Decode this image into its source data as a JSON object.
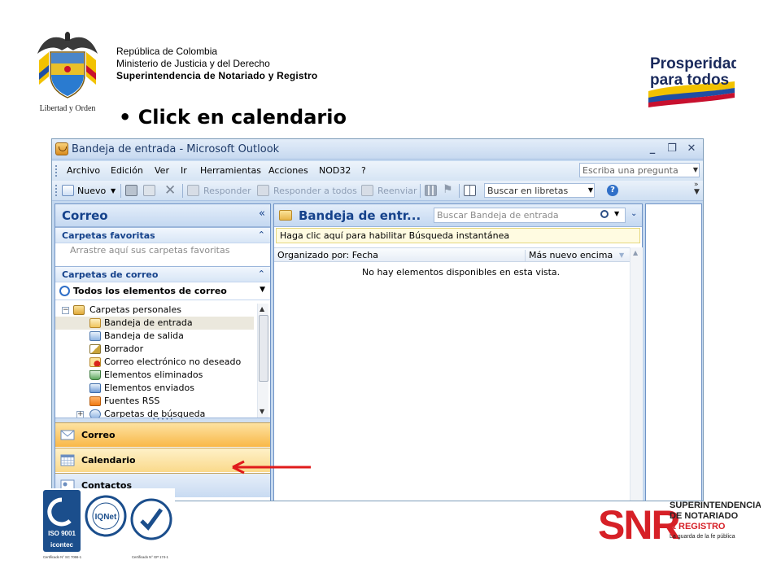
{
  "header": {
    "line1": "República de Colombia",
    "line2": "Ministerio de Justicia y del Derecho",
    "line3": "Superintendencia de Notariado y Registro",
    "motto": "Libertad y Orden"
  },
  "brand": {
    "prosperidad_line1": "Prosperidad",
    "prosperidad_line2": "para todos"
  },
  "slide": {
    "bullet": "• Click en calendario"
  },
  "window": {
    "title": "Bandeja de entrada - Microsoft Outlook",
    "minimize": "_",
    "restore": "❐",
    "close": "✕"
  },
  "menu": {
    "items": [
      "Archivo",
      "Edición",
      "Ver",
      "Ir",
      "Herramientas",
      "Acciones",
      "NOD32",
      "?"
    ],
    "ask_placeholder": "Escriba una pregunta"
  },
  "toolbar": {
    "new": "Nuevo",
    "reply": "Responder",
    "reply_all": "Responder a todos",
    "forward": "Reenviar",
    "search_libretas": "Buscar en libretas"
  },
  "nav": {
    "title": "Correo",
    "favorites_header": "Carpetas favoritas",
    "favorites_hint": "Arrastre aquí sus carpetas favoritas",
    "mail_folders_header": "Carpetas de correo",
    "all_items": "Todos los elementos de correo",
    "tree": [
      {
        "label": "Carpetas personales",
        "level": 0
      },
      {
        "label": "Bandeja de entrada",
        "level": 1
      },
      {
        "label": "Bandeja de salida",
        "level": 1
      },
      {
        "label": "Borrador",
        "level": 1
      },
      {
        "label": "Correo electrónico no deseado",
        "level": 1
      },
      {
        "label": "Elementos eliminados",
        "level": 1
      },
      {
        "label": "Elementos enviados",
        "level": 1
      },
      {
        "label": "Fuentes RSS",
        "level": 1
      },
      {
        "label": "Carpetas de búsqueda",
        "level": 1
      }
    ],
    "buttons": {
      "correo": "Correo",
      "calendario": "Calendario",
      "contactos": "Contactos"
    }
  },
  "mail": {
    "title": "Bandeja de entr...",
    "search_placeholder": "Buscar Bandeja de entrada",
    "instant_search_bar": "Haga clic aquí para habilitar Búsqueda instantánea",
    "sort_by": "Organizado por: Fecha",
    "sort_order": "Más nuevo encima",
    "empty_message": "No hay elementos disponibles en esta vista."
  },
  "footer": {
    "iso_label": "ISO 9001",
    "icontec_label": "icontec",
    "cert_left": "Certificado N° SC 7066-1",
    "cert_right": "Certificado N° GP 174-1",
    "iqnet_label": "IQNet",
    "snr_letters": "SNR",
    "snr_line1": "SUPERINTENDENCIA",
    "snr_line2": "DE NOTARIADO",
    "snr_line3": "& REGISTRO",
    "snr_tagline": "La guarda de la fe pública"
  },
  "colors": {
    "outlook_blue": "#15428b",
    "frame": "#c4d8ef",
    "arrow_red": "#e01b1b",
    "snr_red": "#d62027",
    "nav_orange": "#f9b848"
  },
  "icons": [
    "outlook-icon",
    "new-mail-icon",
    "print-icon",
    "move-icon",
    "delete-icon",
    "reply-icon",
    "reply-all-icon",
    "forward-icon",
    "categorize-icon",
    "flag-icon",
    "address-book-icon",
    "help-icon",
    "folder-icon",
    "search-icon",
    "calendar-icon",
    "mail-icon",
    "contacts-icon"
  ]
}
